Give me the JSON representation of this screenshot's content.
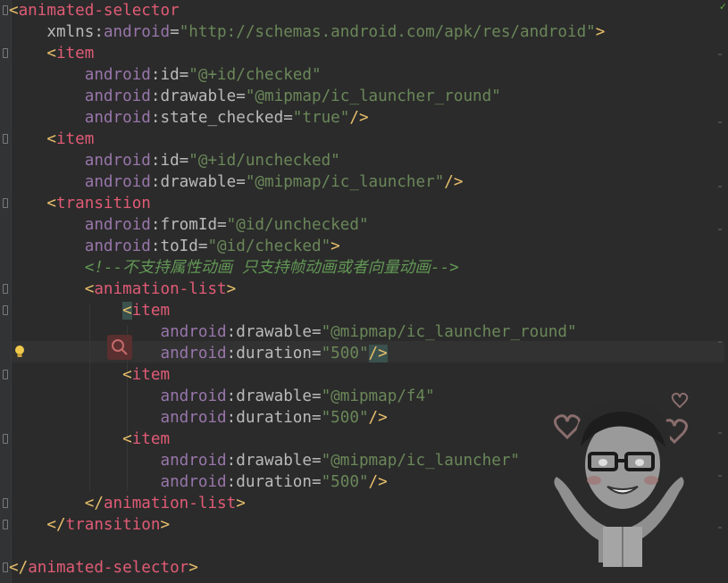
{
  "editor": {
    "status_check": "✓",
    "lines": [
      {
        "indent": "",
        "parts": [
          [
            "tag",
            "<"
          ],
          [
            "tname",
            "animated-selector"
          ]
        ]
      },
      {
        "indent": "    ",
        "parts": [
          [
            "attr",
            "xmlns"
          ],
          [
            "attr",
            ":"
          ],
          [
            "ns",
            "android"
          ],
          [
            "attr",
            "="
          ],
          [
            "str",
            "\"http://schemas.android.com/apk/res/android\""
          ],
          [
            "tag",
            ">"
          ]
        ]
      },
      {
        "indent": "    ",
        "parts": [
          [
            "tag",
            "<"
          ],
          [
            "tname",
            "item"
          ]
        ]
      },
      {
        "indent": "        ",
        "parts": [
          [
            "ns",
            "android"
          ],
          [
            "attr",
            ":id="
          ],
          [
            "str",
            "\"@+id/checked\""
          ]
        ]
      },
      {
        "indent": "        ",
        "parts": [
          [
            "ns",
            "android"
          ],
          [
            "attr",
            ":drawable="
          ],
          [
            "str",
            "\"@mipmap/ic_launcher_round\""
          ]
        ]
      },
      {
        "indent": "        ",
        "parts": [
          [
            "ns",
            "android"
          ],
          [
            "attr",
            ":state_checked="
          ],
          [
            "str",
            "\"true\""
          ],
          [
            "tag",
            "/>"
          ]
        ]
      },
      {
        "indent": "    ",
        "parts": [
          [
            "tag",
            "<"
          ],
          [
            "tname",
            "item"
          ]
        ]
      },
      {
        "indent": "        ",
        "parts": [
          [
            "ns",
            "android"
          ],
          [
            "attr",
            ":id="
          ],
          [
            "str",
            "\"@+id/unchecked\""
          ]
        ]
      },
      {
        "indent": "        ",
        "parts": [
          [
            "ns",
            "android"
          ],
          [
            "attr",
            ":drawable="
          ],
          [
            "str",
            "\"@mipmap/ic_launcher\""
          ],
          [
            "tag",
            "/>"
          ]
        ]
      },
      {
        "indent": "    ",
        "parts": [
          [
            "tag",
            "<"
          ],
          [
            "tname",
            "transition"
          ]
        ]
      },
      {
        "indent": "        ",
        "parts": [
          [
            "ns",
            "android"
          ],
          [
            "attr",
            ":fromId="
          ],
          [
            "str",
            "\"@id/unchecked\""
          ]
        ]
      },
      {
        "indent": "        ",
        "parts": [
          [
            "ns",
            "android"
          ],
          [
            "attr",
            ":toId="
          ],
          [
            "str",
            "\"@id/checked\""
          ],
          [
            "tag",
            ">"
          ]
        ]
      },
      {
        "indent": "        ",
        "parts": [
          [
            "comment",
            "<!--不支持属性动画 只支持帧动画或者向量动画-->"
          ]
        ]
      },
      {
        "indent": "        ",
        "parts": [
          [
            "tag",
            "<"
          ],
          [
            "tname",
            "animation-list"
          ],
          [
            "tag",
            ">"
          ]
        ]
      },
      {
        "indent": "            ",
        "parts": [
          [
            "hltag",
            "<"
          ],
          [
            "tname",
            "item"
          ]
        ]
      },
      {
        "indent": "                ",
        "parts": [
          [
            "ns",
            "android"
          ],
          [
            "attr",
            ":drawable="
          ],
          [
            "str",
            "\"@mipmap/ic_launcher_round\""
          ]
        ]
      },
      {
        "indent": "                ",
        "parts": [
          [
            "ns",
            "android"
          ],
          [
            "attr",
            ":duration="
          ],
          [
            "str",
            "\"500\""
          ],
          [
            "hltag",
            "/>"
          ]
        ]
      },
      {
        "indent": "            ",
        "parts": [
          [
            "tag",
            "<"
          ],
          [
            "tname",
            "item"
          ]
        ]
      },
      {
        "indent": "                ",
        "parts": [
          [
            "ns",
            "android"
          ],
          [
            "attr",
            ":drawable="
          ],
          [
            "str",
            "\"@mipmap/f4\""
          ]
        ]
      },
      {
        "indent": "                ",
        "parts": [
          [
            "ns",
            "android"
          ],
          [
            "attr",
            ":duration="
          ],
          [
            "str",
            "\"500\""
          ],
          [
            "tag",
            "/>"
          ]
        ]
      },
      {
        "indent": "            ",
        "parts": [
          [
            "tag",
            "<"
          ],
          [
            "tname",
            "item"
          ]
        ]
      },
      {
        "indent": "                ",
        "parts": [
          [
            "ns",
            "android"
          ],
          [
            "attr",
            ":drawable="
          ],
          [
            "str",
            "\"@mipmap/ic_launcher\""
          ]
        ]
      },
      {
        "indent": "                ",
        "parts": [
          [
            "ns",
            "android"
          ],
          [
            "attr",
            ":duration="
          ],
          [
            "str",
            "\"500\""
          ],
          [
            "tag",
            "/>"
          ]
        ]
      },
      {
        "indent": "        ",
        "parts": [
          [
            "tag",
            "</"
          ],
          [
            "tname",
            "animation-list"
          ],
          [
            "tag",
            ">"
          ]
        ]
      },
      {
        "indent": "    ",
        "parts": [
          [
            "tag",
            "</"
          ],
          [
            "tname",
            "transition"
          ],
          [
            "tag",
            ">"
          ]
        ]
      },
      {
        "indent": "",
        "parts": [
          [
            "tag",
            ""
          ]
        ]
      },
      {
        "indent": "",
        "parts": [
          [
            "tag",
            "</"
          ],
          [
            "tname",
            "animated-selector"
          ],
          [
            "tag",
            ">"
          ]
        ]
      }
    ]
  },
  "colors": {
    "background": "#2b2b2b",
    "tag": "#e8bf6a",
    "tag_name": "#e8bf6a",
    "namespace": "#9876aa",
    "attribute": "#bababa",
    "string": "#6a8759",
    "comment": "#629755",
    "keyword_pink": "#cc5f9e"
  },
  "icons": [
    "lightbulb-icon",
    "search-icon",
    "cartoon-avatar-icon"
  ]
}
